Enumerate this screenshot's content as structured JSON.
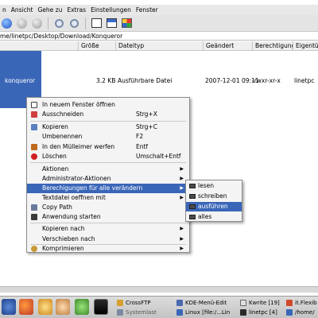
{
  "menubar": {
    "items": [
      "n",
      "Ansicht",
      "Gehe zu",
      "Extras",
      "Einstellungen",
      "Fenster"
    ]
  },
  "location": {
    "path": "me/linetpc/Desktop/Download/Konqueror"
  },
  "filelist": {
    "columns": [
      "Größe",
      "Dateityp",
      "Geändert",
      "Berechtigungen",
      "Eigentü"
    ],
    "row": {
      "name": "konqueror",
      "size": "3.2 KB",
      "type": "Ausführbare Datei",
      "modified": "2007-12-01 09:11",
      "permissions": "-rwxr-xr-x",
      "owner": "linetpc"
    }
  },
  "context_menu": {
    "items": [
      {
        "label": "In neuem Fenster öffnen",
        "shortcut": "",
        "icon": "new-window-icon",
        "icon_color": "#ffffff"
      },
      {
        "label": "Ausschneiden",
        "shortcut": "Strg+X",
        "icon": "scissors-icon",
        "icon_color": "#d04040"
      },
      {
        "label": "Kopieren",
        "shortcut": "Strg+C",
        "icon": "copy-icon",
        "icon_color": "#5a7fc0"
      },
      {
        "label": "Umbenennen",
        "shortcut": "F2",
        "icon": "",
        "icon_color": ""
      },
      {
        "label": "In den Mülleimer werfen",
        "shortcut": "Entf",
        "icon": "trash-icon",
        "icon_color": "#c06a20"
      },
      {
        "label": "Löschen",
        "shortcut": "Umschalt+Entf",
        "icon": "delete-icon",
        "icon_color": "#d02020"
      },
      {
        "label": "Aktionen",
        "shortcut": "",
        "icon": "",
        "icon_color": ""
      },
      {
        "label": "Administrator-Aktionen",
        "shortcut": "",
        "icon": "",
        "icon_color": ""
      },
      {
        "label": "Berechigungen für alle verändern",
        "shortcut": "",
        "icon": "",
        "icon_color": ""
      },
      {
        "label": "Textdatei oeffnen mit",
        "shortcut": "",
        "icon": "",
        "icon_color": ""
      },
      {
        "label": "Copy Path",
        "shortcut": "",
        "icon": "copy-path-icon",
        "icon_color": "#6a7a9a"
      },
      {
        "label": "Anwendung starten",
        "shortcut": "",
        "icon": "terminal-icon",
        "icon_color": "#3a3a3a"
      },
      {
        "label": "Kopieren nach",
        "shortcut": "",
        "icon": "",
        "icon_color": ""
      },
      {
        "label": "Verschieben nach",
        "shortcut": "",
        "icon": "",
        "icon_color": ""
      },
      {
        "label": "Komprimieren",
        "shortcut": "",
        "icon": "archive-icon",
        "icon_color": "#c89a3a"
      }
    ]
  },
  "submenu": {
    "items": [
      "lesen",
      "schreiben",
      "ausführen",
      "alles"
    ]
  },
  "taskbar": {
    "tasks": [
      {
        "label": "CrossFTP"
      },
      {
        "label": "Systemlast"
      },
      {
        "label": "KDE-Menü-Edit"
      },
      {
        "label": "Linux [file:/...Lin"
      },
      {
        "label": "Kwrite [19]"
      },
      {
        "label": "linetpc [4]"
      },
      {
        "label": "it.Flexib"
      },
      {
        "label": "/home/"
      }
    ]
  },
  "colors": {
    "selection": "#3a66b8",
    "menu_bg": "#f4f4f4"
  }
}
